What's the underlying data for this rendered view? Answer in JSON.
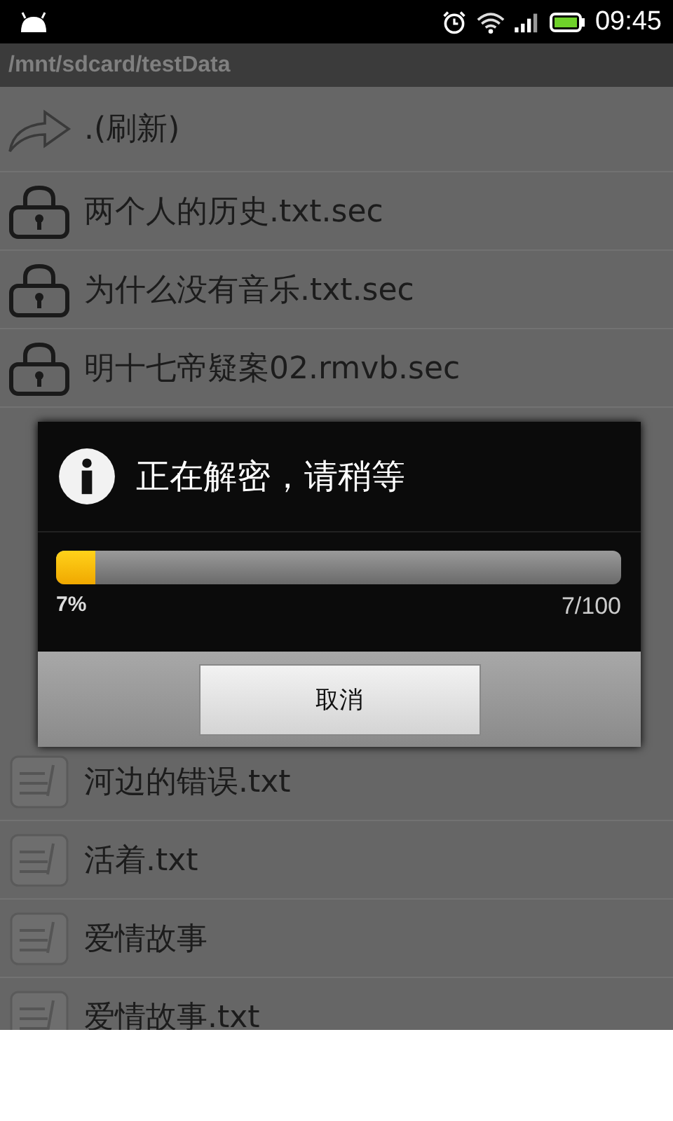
{
  "status_bar": {
    "time": "09:45"
  },
  "path_bar": {
    "path": "/mnt/sdcard/testData"
  },
  "files": [
    {
      "kind": "up",
      "name": ".(刷新)"
    },
    {
      "kind": "locked",
      "name": "两个人的历史.txt.sec"
    },
    {
      "kind": "locked",
      "name": "为什么没有音乐.txt.sec"
    },
    {
      "kind": "locked",
      "name": "明十七帝疑案02.rmvb.sec"
    },
    {
      "kind": "file",
      "name": "河边的错误.txt"
    },
    {
      "kind": "file",
      "name": "活着.txt"
    },
    {
      "kind": "file",
      "name": "爱情故事"
    },
    {
      "kind": "file",
      "name": "爱情故事.txt"
    }
  ],
  "dialog": {
    "title": "正在解密，请稍等",
    "progress": {
      "level": 0.07,
      "percent": "7%",
      "count": "7/100"
    },
    "buttons": [
      "取消"
    ]
  }
}
